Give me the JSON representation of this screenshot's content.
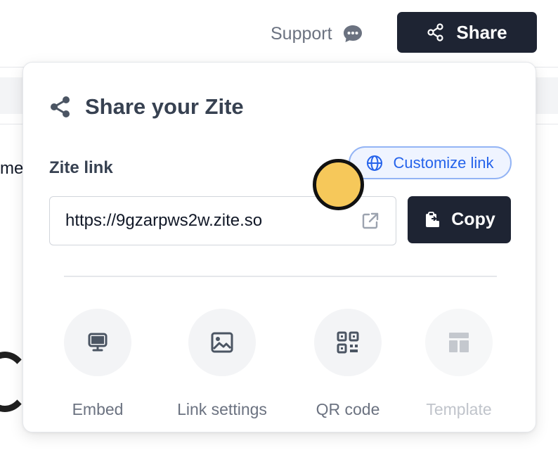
{
  "header": {
    "support_label": "Support",
    "support_icon": "chat-bubble-icon",
    "share_label": "Share",
    "share_icon": "share-icon"
  },
  "background": {
    "fragment_text": "me"
  },
  "share_panel": {
    "title": "Share your Zite",
    "title_icon": "share-icon",
    "link_label": "Zite link",
    "customize_label": "Customize link",
    "customize_icon": "globe-icon",
    "url_value": "https://9gzarpws2w.zite.so",
    "open_icon": "external-link-icon",
    "copy_label": "Copy",
    "copy_icon": "clipboard-icon",
    "actions": [
      {
        "label": "Embed",
        "icon": "monitor-icon",
        "enabled": true
      },
      {
        "label": "Link settings",
        "icon": "image-icon",
        "enabled": true
      },
      {
        "label": "QR code",
        "icon": "qr-code-icon",
        "enabled": true
      },
      {
        "label": "Template",
        "icon": "layout-template-icon",
        "enabled": false
      }
    ]
  },
  "colors": {
    "dark_button": "#1e2433",
    "accent_blue": "#2563eb",
    "cursor_marker": "#f6c85a"
  }
}
